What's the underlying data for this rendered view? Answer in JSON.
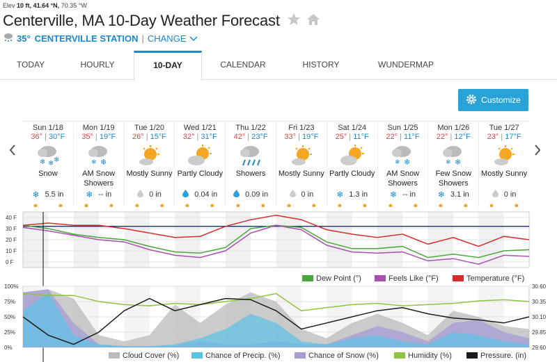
{
  "header": {
    "elev_label": "Elev",
    "elev_value": "10 ft,",
    "lat": "41.64 °N,",
    "lon": "70.35 °W",
    "title": "Centerville, MA 10-Day Weather Forecast",
    "station_temp": "35°",
    "station_name": "CENTERVILLE STATION",
    "station_change": "CHANGE"
  },
  "tabs": [
    {
      "label": "TODAY"
    },
    {
      "label": "HOURLY"
    },
    {
      "label": "10-DAY"
    },
    {
      "label": "CALENDAR"
    },
    {
      "label": "HISTORY"
    },
    {
      "label": "WUNDERMAP"
    }
  ],
  "customize_label": "Customize",
  "days": [
    {
      "date": "Sun 1/18",
      "hi": "36°",
      "lo": "30°F",
      "icon": "snow-icon",
      "cond": "Snow",
      "precip_icon": "snowflake-icon",
      "precip": "5.5 in"
    },
    {
      "date": "Mon 1/19",
      "hi": "35°",
      "lo": "19°F",
      "icon": "snow-showers-icon",
      "cond": "AM Snow Showers",
      "precip_icon": "snowflake-icon",
      "precip": "-- in"
    },
    {
      "date": "Tue 1/20",
      "hi": "26°",
      "lo": "15°F",
      "icon": "mostly-sunny-icon",
      "cond": "Mostly Sunny",
      "precip_icon": "drop-icon",
      "precip": "0 in"
    },
    {
      "date": "Wed 1/21",
      "hi": "32°",
      "lo": "31°F",
      "icon": "partly-cloudy-icon",
      "cond": "Partly Cloudy",
      "precip_icon": "drop-icon",
      "precip": "0.04 in"
    },
    {
      "date": "Thu 1/22",
      "hi": "42°",
      "lo": "23°F",
      "icon": "showers-icon",
      "cond": "Showers",
      "precip_icon": "drop-icon",
      "precip": "0.09 in"
    },
    {
      "date": "Fri 1/23",
      "hi": "33°",
      "lo": "19°F",
      "icon": "mostly-sunny-icon",
      "cond": "Mostly Sunny",
      "precip_icon": "drop-icon",
      "precip": "0 in"
    },
    {
      "date": "Sat 1/24",
      "hi": "25°",
      "lo": "11°F",
      "icon": "partly-cloudy-icon",
      "cond": "Partly Cloudy",
      "precip_icon": "snowflake-icon",
      "precip": "1.3 in"
    },
    {
      "date": "Sun 1/25",
      "hi": "22°",
      "lo": "11°F",
      "icon": "snow-showers-icon",
      "cond": "AM Snow Showers",
      "precip_icon": "snowflake-icon",
      "precip": "-- in"
    },
    {
      "date": "Mon 1/26",
      "hi": "22°",
      "lo": "12°F",
      "icon": "snow-showers-icon",
      "cond": "Few Snow Showers",
      "precip_icon": "snowflake-icon",
      "precip": "3.1 in"
    },
    {
      "date": "Tue 1/27",
      "hi": "23°",
      "lo": "17°F",
      "icon": "mostly-sunny-icon",
      "cond": "Mostly Sunny",
      "precip_icon": "drop-icon",
      "precip": "0 in"
    }
  ],
  "chart_data": [
    {
      "type": "line",
      "title": "",
      "xlabel": "",
      "ylabel": "",
      "ylim": [
        -5,
        45
      ],
      "y_ticks": [
        "40 F",
        "30 F",
        "20 F",
        "10 F",
        "0 F"
      ],
      "x_hours": [
        0,
        12,
        24,
        36,
        48,
        60,
        72,
        84,
        96,
        108,
        120,
        132,
        144,
        156,
        168,
        180,
        192,
        204,
        216,
        228,
        240
      ],
      "series": [
        {
          "name": "Dew Point (°)",
          "color": "#4aa63c",
          "values": [
            33,
            30,
            25,
            22,
            20,
            14,
            9,
            8,
            13,
            30,
            33,
            31,
            18,
            12,
            12,
            14,
            4,
            7,
            4,
            10,
            11
          ]
        },
        {
          "name": "Feels Like (°F)",
          "color": "#a94fb0",
          "values": [
            31,
            28,
            24,
            20,
            18,
            11,
            6,
            4,
            10,
            26,
            33,
            29,
            15,
            9,
            8,
            9,
            1,
            3,
            -2,
            6,
            5
          ]
        },
        {
          "name": "Temperature (°F)",
          "color": "#d32d2d",
          "values": [
            33,
            35,
            33,
            33,
            30,
            26,
            22,
            23,
            32,
            38,
            42,
            38,
            29,
            25,
            22,
            25,
            16,
            22,
            14,
            23,
            20
          ]
        }
      ],
      "freezing_line": 32,
      "grid": true,
      "legend": "bottom-right"
    },
    {
      "type": "area",
      "title": "",
      "xlabel": "",
      "ylabel": "",
      "ylim": [
        0,
        100
      ],
      "y_ticks_left": [
        "100%",
        "75%",
        "50%",
        "25%",
        "0%"
      ],
      "y_ticks_right": [
        "30.60",
        "30.35",
        "30.10",
        "29.85",
        "29.60"
      ],
      "x_hours": [
        0,
        12,
        24,
        36,
        48,
        60,
        72,
        84,
        96,
        108,
        120,
        132,
        144,
        156,
        168,
        180,
        192,
        204,
        216,
        228,
        240
      ],
      "series": [
        {
          "name": "Cloud Cover (%)",
          "color": "#bbbbbb",
          "values": [
            90,
            95,
            80,
            20,
            10,
            20,
            70,
            40,
            70,
            90,
            75,
            30,
            15,
            40,
            55,
            40,
            20,
            60,
            50,
            35,
            30
          ]
        },
        {
          "name": "Chance of Precip. (%)",
          "color": "#5bc2e7",
          "values": [
            60,
            90,
            20,
            5,
            2,
            2,
            5,
            15,
            30,
            55,
            40,
            10,
            5,
            15,
            20,
            10,
            5,
            25,
            20,
            10,
            5
          ]
        },
        {
          "name": "Chance of Snow (%)",
          "color": "#a89bd6",
          "values": [
            90,
            95,
            40,
            5,
            2,
            2,
            3,
            10,
            5,
            5,
            10,
            5,
            5,
            20,
            35,
            25,
            10,
            40,
            45,
            25,
            15
          ]
        },
        {
          "name": "Humidity (%)",
          "color": "#8cc63f",
          "values": [
            88,
            85,
            85,
            75,
            70,
            68,
            72,
            70,
            75,
            80,
            88,
            60,
            65,
            70,
            72,
            68,
            70,
            72,
            76,
            78,
            75
          ]
        },
        {
          "name": "Pressure. (in)",
          "color": "#1b1b1b",
          "values": [
            50,
            20,
            5,
            25,
            60,
            80,
            60,
            70,
            80,
            78,
            60,
            30,
            40,
            50,
            60,
            65,
            55,
            48,
            45,
            40,
            50
          ]
        }
      ],
      "grid": true,
      "legend": "bottom"
    }
  ]
}
